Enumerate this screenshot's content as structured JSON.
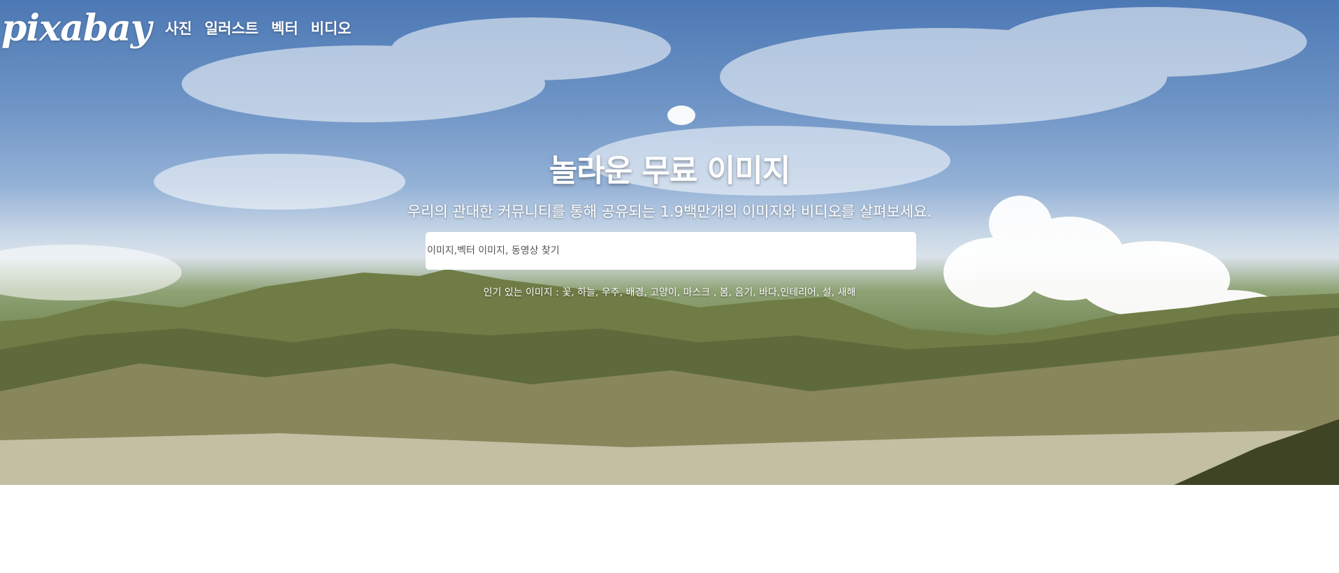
{
  "brand": {
    "logo_text": "pixabay"
  },
  "nav": {
    "items": [
      "사진",
      "일러스트",
      "벡터",
      "비디오"
    ]
  },
  "hero": {
    "title": "놀라운 무료 이미지",
    "subtitle": "우리의 관대한 커뮤니티를 통해 공유되는 1.9백만개의 이미지와 비디오를 살펴보세요.",
    "search_placeholder": "이미지,벡터 이미지, 동영상 찾기",
    "popular_label": "인기 있는 이미지 :",
    "popular_tags": [
      "꽃",
      "하늘",
      "우주",
      "배경",
      "고양이",
      "마스크",
      "봄",
      "음기",
      "바다",
      "인테리어",
      "설",
      "새해"
    ]
  }
}
